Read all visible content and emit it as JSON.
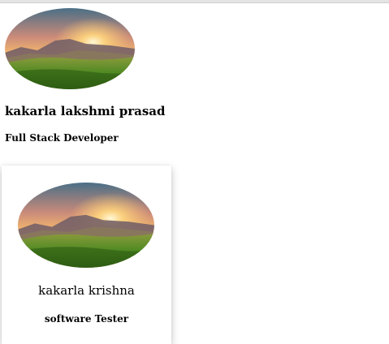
{
  "profile_plain": {
    "image_alt": "mountain sunset landscape",
    "name": "kakarla lakshmi prasad",
    "role": "Full Stack Developer"
  },
  "profile_card": {
    "image_alt": "mountain sunset landscape",
    "name": "kakarla krishna",
    "role": "software Tester"
  },
  "colors": {
    "sky_top": "#3a6f8f",
    "sky_glow": "#f4b66a",
    "sun": "#fff3c4",
    "mountain": "#6b5a5e",
    "grass": "#3f7a1f"
  }
}
